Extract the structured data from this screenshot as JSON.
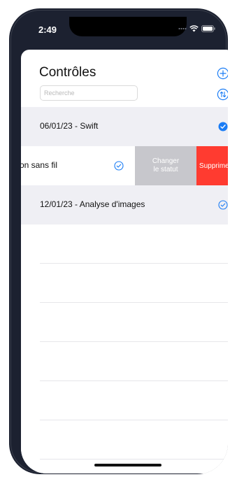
{
  "status_bar": {
    "time": "2:49",
    "icons": [
      "cellular-dots-icon",
      "wifi-icon",
      "battery-icon"
    ]
  },
  "header": {
    "title": "Contrôles",
    "search_placeholder": "Recherche",
    "search_value": "",
    "add_icon": "plus-circle-icon",
    "sort_icon": "sort-arrows-icon"
  },
  "rows": [
    {
      "label": "06/01/23 - Swift",
      "checked": true
    },
    {
      "label": "on sans fil",
      "checked": false,
      "swiped": true
    },
    {
      "label": "12/01/23 - Analyse d'images",
      "checked": false
    }
  ],
  "swipe_actions": {
    "change_status_line1": "Changer",
    "change_status_line2": "le statut",
    "delete": "Supprimer"
  },
  "colors": {
    "accent": "#1a7cf5",
    "delete": "#ff3b30",
    "status_action": "#c7c7cc",
    "row_fill": "#efeff4",
    "device": "#1c2130"
  }
}
